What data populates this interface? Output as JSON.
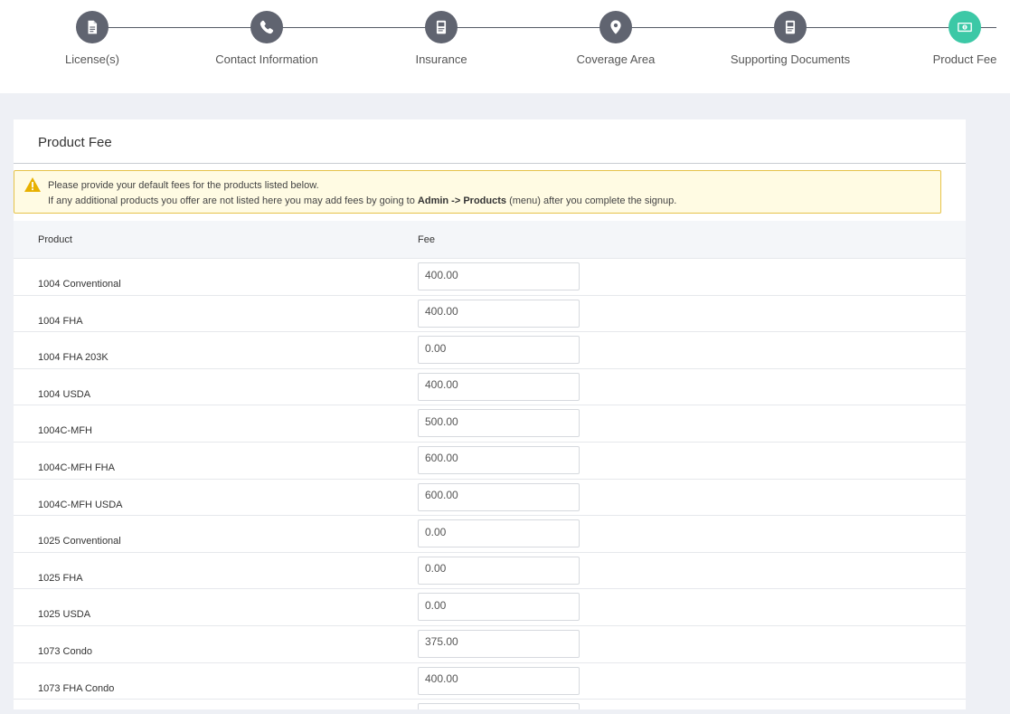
{
  "stepper": {
    "steps": [
      {
        "label": "License(s)",
        "icon": "document-icon",
        "active": false
      },
      {
        "label": "Contact Information",
        "icon": "phone-icon",
        "active": false
      },
      {
        "label": "Insurance",
        "icon": "id-card-icon",
        "active": false
      },
      {
        "label": "Coverage Area",
        "icon": "map-pin-icon",
        "active": false
      },
      {
        "label": "Supporting Documents",
        "icon": "id-card-icon",
        "active": false
      },
      {
        "label": "Product Fee",
        "icon": "money-icon",
        "active": true
      }
    ],
    "colors": {
      "inactive": "#606470",
      "active": "#3cc8a6"
    }
  },
  "card": {
    "title": "Product Fee"
  },
  "alert": {
    "icon": "warning-icon",
    "line1": "Please provide your default fees for the products listed below.",
    "line2_prefix": "If any additional products you offer are not listed here you may add fees by going to",
    "line2_bold": "Admin -> Products",
    "line2_suffix": "(menu) after you complete the signup."
  },
  "table": {
    "headers": {
      "product": "Product",
      "fee": "Fee"
    },
    "rows": [
      {
        "product": "1004 Conventional",
        "fee": "400.00"
      },
      {
        "product": "1004 FHA",
        "fee": "400.00"
      },
      {
        "product": "1004 FHA 203K",
        "fee": "0.00"
      },
      {
        "product": "1004 USDA",
        "fee": "400.00"
      },
      {
        "product": "1004C-MFH",
        "fee": "500.00"
      },
      {
        "product": "1004C-MFH FHA",
        "fee": "600.00"
      },
      {
        "product": "1004C-MFH USDA",
        "fee": "600.00"
      },
      {
        "product": "1025 Conventional",
        "fee": "0.00"
      },
      {
        "product": "1025 FHA",
        "fee": "0.00"
      },
      {
        "product": "1025 USDA",
        "fee": "0.00"
      },
      {
        "product": "1073 Condo",
        "fee": "375.00"
      },
      {
        "product": "1073 FHA Condo",
        "fee": "400.00"
      },
      {
        "product": "",
        "fee": ""
      }
    ]
  }
}
